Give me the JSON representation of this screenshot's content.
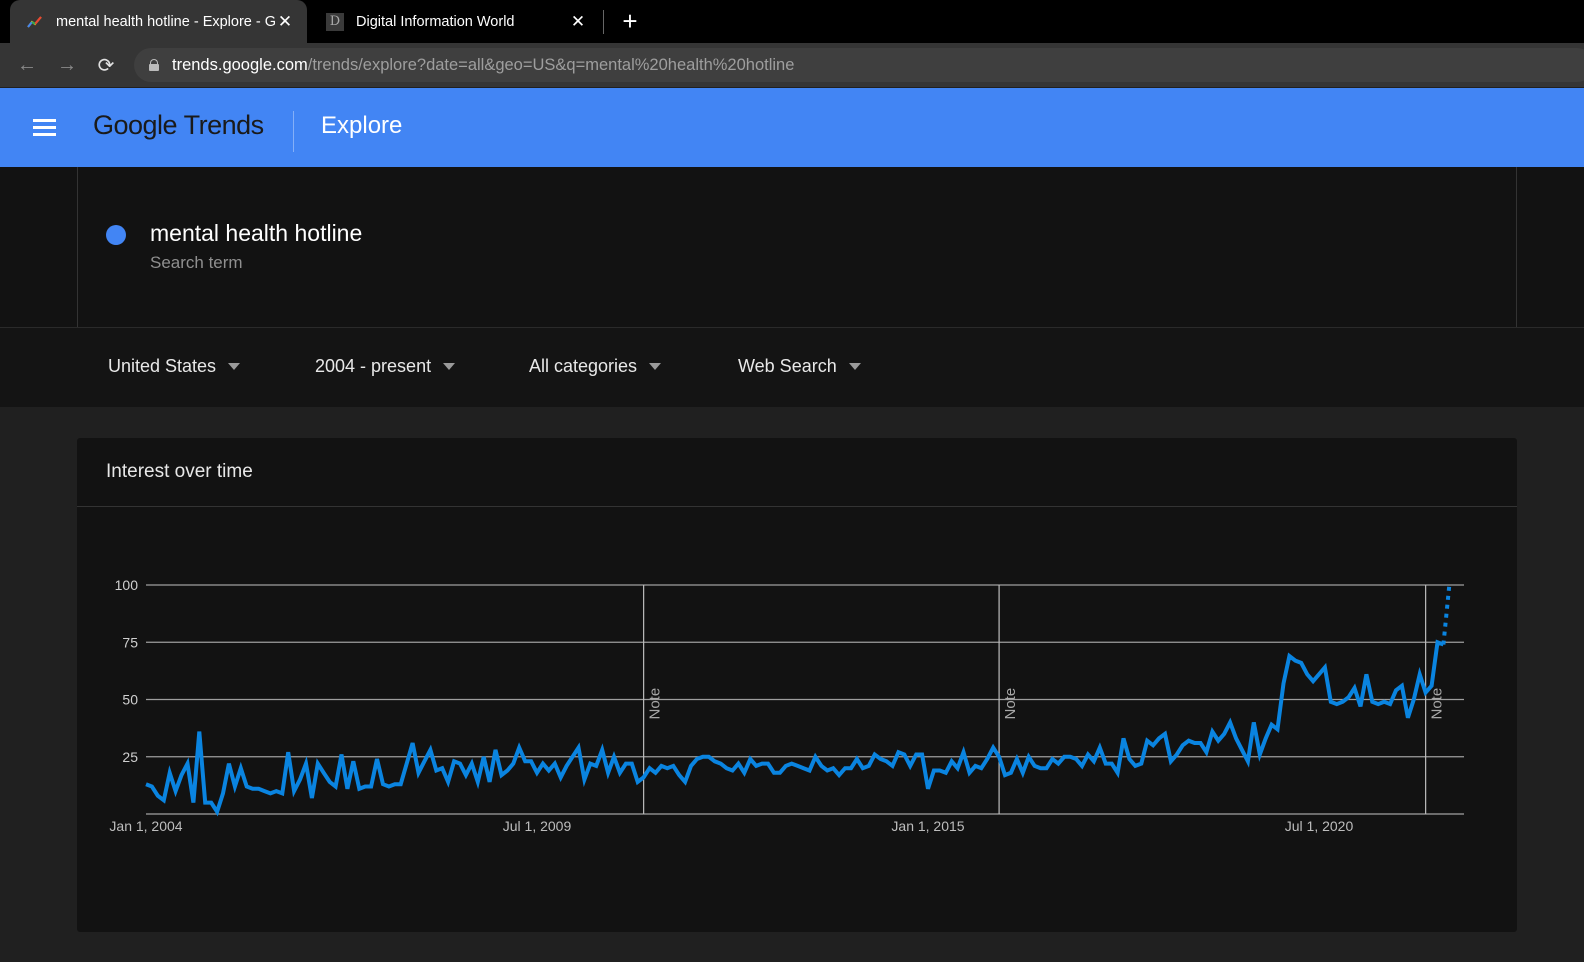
{
  "browser": {
    "tabs": [
      {
        "title": "mental health hotline - Explore - Google Trends",
        "active": true,
        "favicon": "google-trends-icon"
      },
      {
        "title": "Digital Information World",
        "active": false,
        "favicon": "D"
      }
    ],
    "new_tab_label": "+",
    "close_glyph": "✕",
    "url_host": "trends.google.com",
    "url_path": "/trends/explore?date=all&geo=US&q=mental%20health%20hotline",
    "nav": {
      "back": "←",
      "forward": "→",
      "reload": "⟳"
    }
  },
  "header": {
    "logo_google": "Google",
    "logo_trends": "Trends",
    "page": "Explore"
  },
  "search_term": {
    "name": "mental health hotline",
    "type": "Search term",
    "color": "#4285f4"
  },
  "filters": {
    "region": "United States",
    "time": "2004 - present",
    "category": "All categories",
    "property": "Web Search"
  },
  "card": {
    "title": "Interest over time"
  },
  "chart_data": {
    "type": "line",
    "title": "Interest over time",
    "xlabel": "",
    "ylabel": "",
    "ylim": [
      0,
      100
    ],
    "yticks": [
      25,
      50,
      75,
      100
    ],
    "ytick_labels": [
      "25",
      "50",
      "75",
      "100"
    ],
    "xtick_labels": [
      "Jan 1, 2004",
      "Jul 1, 2009",
      "Jan 1, 2015",
      "Jul 1, 2020"
    ],
    "xtick_months": [
      0,
      66,
      132,
      198
    ],
    "start": "2004-01",
    "interval": "month",
    "grid": true,
    "legend": "none",
    "line_color": "#0a84e0",
    "notes": [
      {
        "label": "Note",
        "month_index": 84
      },
      {
        "label": "Note",
        "month_index": 144
      },
      {
        "label": "Note",
        "month_index": 216
      }
    ],
    "partial_last_point": true,
    "series": [
      {
        "name": "mental health hotline",
        "values": [
          13,
          12,
          8,
          6,
          18,
          10,
          17,
          22,
          5,
          36,
          5,
          5,
          1,
          9,
          22,
          12,
          20,
          12,
          11,
          11,
          10,
          9,
          10,
          9,
          27,
          10,
          15,
          22,
          7,
          22,
          18,
          14,
          12,
          26,
          11,
          23,
          11,
          12,
          12,
          24,
          13,
          12,
          13,
          13,
          22,
          31,
          18,
          23,
          28,
          19,
          20,
          14,
          23,
          22,
          17,
          22,
          14,
          25,
          14,
          28,
          17,
          19,
          22,
          29,
          23,
          23,
          18,
          22,
          19,
          22,
          16,
          21,
          25,
          29,
          15,
          22,
          21,
          28,
          18,
          25,
          18,
          22,
          22,
          14,
          16,
          20,
          18,
          21,
          20,
          21,
          17,
          14,
          21,
          24,
          25,
          25,
          23,
          22,
          20,
          19,
          22,
          18,
          24,
          21,
          22,
          22,
          18,
          18,
          21,
          22,
          21,
          20,
          19,
          25,
          21,
          19,
          20,
          17,
          20,
          20,
          24,
          20,
          21,
          26,
          24,
          23,
          21,
          27,
          26,
          21,
          26,
          26,
          11,
          19,
          19,
          18,
          23,
          20,
          27,
          18,
          21,
          20,
          24,
          29,
          25,
          17,
          18,
          24,
          18,
          25,
          21,
          20,
          20,
          24,
          22,
          25,
          25,
          24,
          21,
          26,
          23,
          29,
          22,
          22,
          18,
          33,
          24,
          21,
          22,
          32,
          30,
          33,
          35,
          23,
          26,
          30,
          32,
          31,
          31,
          27,
          36,
          32,
          35,
          40,
          33,
          28,
          23,
          40,
          26,
          33,
          39,
          37,
          57,
          69,
          67,
          66,
          61,
          58,
          61,
          64,
          49,
          48,
          49,
          51,
          55,
          47,
          61,
          49,
          48,
          49,
          48,
          54,
          56,
          42,
          50,
          61,
          53,
          56,
          75,
          74,
          100
        ]
      }
    ]
  }
}
